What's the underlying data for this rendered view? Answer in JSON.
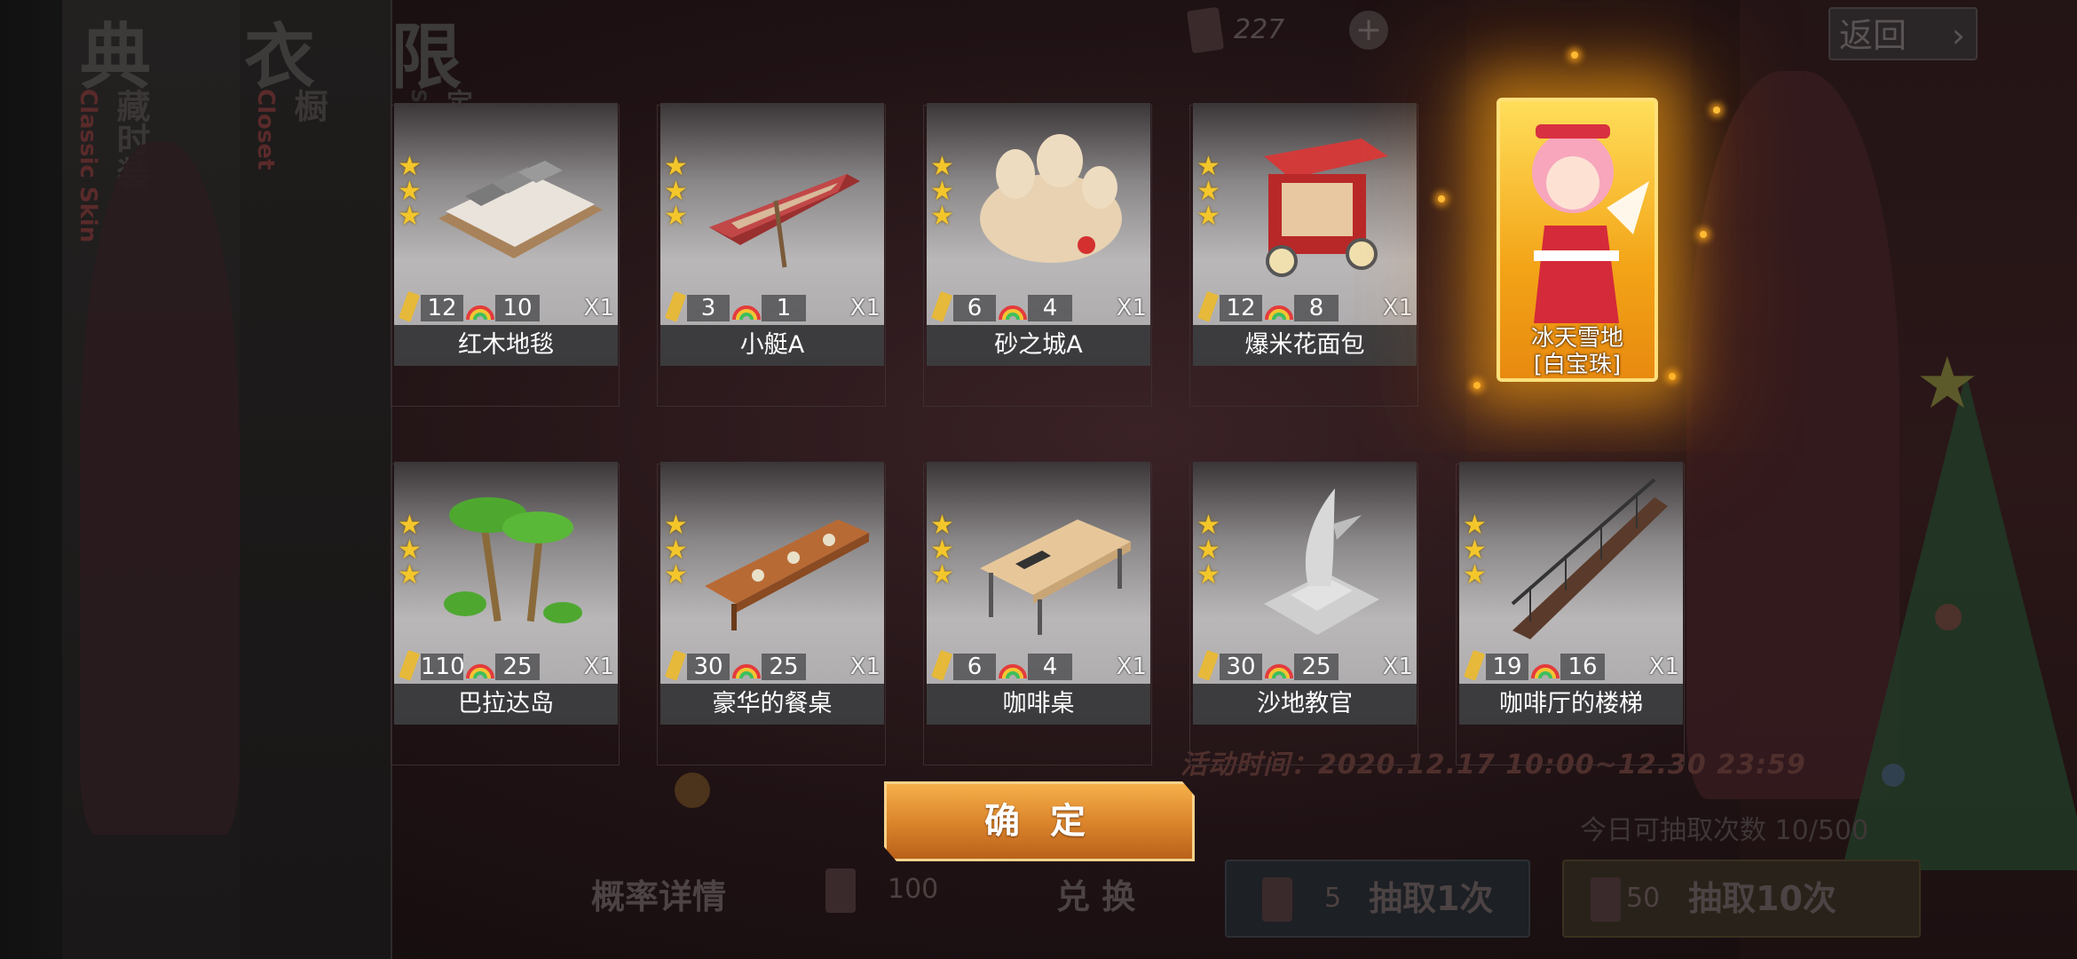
{
  "background": {
    "tabs": [
      {
        "big": "典",
        "sub": "藏时装",
        "en": "Classic Skin"
      },
      {
        "big": "衣",
        "sub": "橱",
        "en": "Closet"
      },
      {
        "big": "限",
        "sub": "定时",
        "en": "Special"
      }
    ],
    "currency_count": "227",
    "return_label": "返回",
    "event_time": "活动时间：2020.12.17 10:00~12.30 23:59",
    "draw_count": "今日可抽取次数 10/500",
    "bottom_bar": {
      "details": "概率详情",
      "exchange_cost": "100",
      "exchange": "兑 换",
      "draw1_cost": "5",
      "draw1": "抽取1次",
      "draw10_cost": "50",
      "draw10": "抽取10次"
    }
  },
  "rewards": [
    {
      "name": "红木地毯",
      "stars": 3,
      "stat1": "12",
      "stat2": "10",
      "qty": "X1",
      "icon": "bed-icon"
    },
    {
      "name": "小艇A",
      "stars": 3,
      "stat1": "3",
      "stat2": "1",
      "qty": "X1",
      "icon": "boat-icon"
    },
    {
      "name": "砂之城A",
      "stars": 3,
      "stat1": "6",
      "stat2": "4",
      "qty": "X1",
      "icon": "sandcastle-icon"
    },
    {
      "name": "爆米花面包",
      "stars": 3,
      "stat1": "12",
      "stat2": "8",
      "qty": "X1",
      "icon": "popcorn-cart-icon"
    },
    {
      "name": "巴拉达岛",
      "stars": 3,
      "stat1": "110",
      "stat2": "25",
      "qty": "X1",
      "icon": "palm-tree-icon"
    },
    {
      "name": "豪华的餐桌",
      "stars": 3,
      "stat1": "30",
      "stat2": "25",
      "qty": "X1",
      "icon": "dining-table-icon"
    },
    {
      "name": "咖啡桌",
      "stars": 3,
      "stat1": "6",
      "stat2": "4",
      "qty": "X1",
      "icon": "coffee-table-icon"
    },
    {
      "name": "沙地教官",
      "stars": 3,
      "stat1": "30",
      "stat2": "25",
      "qty": "X1",
      "icon": "shark-statue-icon"
    },
    {
      "name": "咖啡厅的楼梯",
      "stars": 3,
      "stat1": "19",
      "stat2": "16",
      "qty": "X1",
      "icon": "staircase-icon"
    }
  ],
  "special_reward": {
    "name_line1": "冰天雪地",
    "name_line2": "[白宝珠]",
    "icon": "character-card-icon"
  },
  "confirm_label": "确 定",
  "colors": {
    "gold": "#f3c62b",
    "confirm": "#d9822a",
    "glow": "#ffb020"
  }
}
